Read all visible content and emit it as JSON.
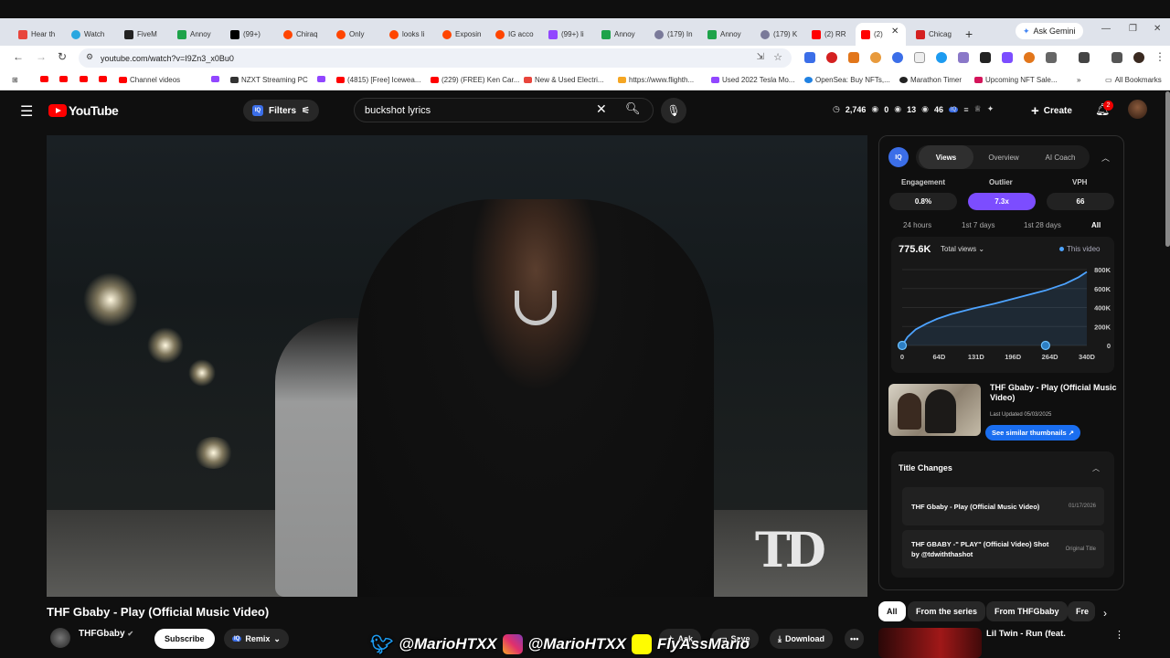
{
  "browser": {
    "tabs": [
      {
        "label": "Hear th",
        "color": "#e8453c"
      },
      {
        "label": "Watch",
        "color": "#2aa7e0"
      },
      {
        "label": "FiveM",
        "color": "#222222"
      },
      {
        "label": "Annoy",
        "color": "#1ea34a"
      },
      {
        "label": "(99+)",
        "color": "#000000"
      },
      {
        "label": "Chiraq",
        "color": "#ff4500"
      },
      {
        "label": "Only",
        "color": "#ff4500"
      },
      {
        "label": "looks li",
        "color": "#ff4500"
      },
      {
        "label": "Exposin",
        "color": "#ff4500"
      },
      {
        "label": "IG acco",
        "color": "#ff4500"
      },
      {
        "label": "(99+) li",
        "color": "#9146ff"
      },
      {
        "label": "Annoy",
        "color": "#1ea34a"
      },
      {
        "label": "(179) In",
        "color": "#7a7a9a"
      },
      {
        "label": "Annoy",
        "color": "#1ea34a"
      },
      {
        "label": "(179) K",
        "color": "#7a7a9a"
      },
      {
        "label": "(2) RR",
        "color": "#ff0000"
      },
      {
        "label": "(2)",
        "color": "#ff0000"
      },
      {
        "label": "Chicag",
        "color": "#d42020"
      }
    ],
    "new_tab": "+",
    "ask_gemini": "Ask Gemini",
    "url": "youtube.com/watch?v=I9Zn3_x0Bu0",
    "bookmarks": [
      {
        "label": "",
        "color": "#ff0000"
      },
      {
        "label": "",
        "color": "#ff0000"
      },
      {
        "label": "",
        "color": "#ff0000"
      },
      {
        "label": "",
        "color": "#ff0000"
      },
      {
        "label": "Channel videos",
        "color": "#ff0000"
      },
      {
        "label": "",
        "color": "#9146ff"
      },
      {
        "label": "NZXT Streaming PC",
        "color": "#333333"
      },
      {
        "label": "",
        "color": "#9146ff"
      },
      {
        "label": "(4815) [Free] Icewea...",
        "color": "#ff0000"
      },
      {
        "label": "(229) (FREE) Ken Car...",
        "color": "#ff0000"
      },
      {
        "label": "New & Used Electri...",
        "color": "#e8453c"
      },
      {
        "label": "https://www.flighth...",
        "color": "#f5a623"
      },
      {
        "label": "Used 2022 Tesla Mo...",
        "color": "#9146ff"
      },
      {
        "label": "OpenSea: Buy NFTs,...",
        "color": "#2081e2"
      },
      {
        "label": "Marathon Timer",
        "color": "#222222"
      },
      {
        "label": "Upcoming NFT Sale...",
        "color": "#d4145a"
      }
    ],
    "all_bookmarks": "All Bookmarks"
  },
  "youtube": {
    "logo_text": "YouTube",
    "filters_label": "Filters",
    "search_value": "buckshot lyrics",
    "stats": {
      "a": "2,746",
      "b": "0",
      "c": "13",
      "d": "46"
    },
    "create_label": "Create",
    "notifications": "2"
  },
  "iq": {
    "logo": "IQ",
    "tabs": [
      "Views",
      "Overview",
      "AI Coach"
    ],
    "metrics": [
      {
        "label": "Engagement",
        "value": "0.8%"
      },
      {
        "label": "Outlier",
        "value": "7.3x"
      },
      {
        "label": "VPH",
        "value": "66"
      }
    ],
    "ranges": [
      "24 hours",
      "1st 7 days",
      "1st 28 days",
      "All"
    ],
    "views_total": "775.6K",
    "views_select": "Total views",
    "legend": "This video",
    "thumb_title": "THF Gbaby - Play (Official Music Video)",
    "last_updated": "Last Updated 05/03/2025",
    "similar_label": "See similar thumbnails",
    "title_changes_heading": "Title Changes",
    "title_changes": [
      {
        "title": "THF Gbaby - Play (Official Music Video)",
        "note": "01/17/2026"
      },
      {
        "title": "THF GBABY -\" PLAY\" (Official Video) Shot by @tdwiththashot",
        "note": "Original Title"
      }
    ]
  },
  "chart_data": {
    "type": "line",
    "title": "",
    "xlabel": "",
    "ylabel": "",
    "x_ticks": [
      "0",
      "64D",
      "131D",
      "196D",
      "264D",
      "340D"
    ],
    "y_ticks": [
      "0",
      "200K",
      "400K",
      "600K",
      "800K"
    ],
    "ylim": [
      0,
      800000
    ],
    "xlim": [
      0,
      340
    ],
    "series": [
      {
        "name": "This video",
        "color": "#4da3ff",
        "x": [
          0,
          10,
          25,
          45,
          64,
          90,
          131,
          170,
          196,
          230,
          264,
          300,
          325,
          340
        ],
        "y": [
          0,
          90000,
          170000,
          230000,
          280000,
          330000,
          390000,
          440000,
          480000,
          530000,
          580000,
          650000,
          720000,
          775600
        ]
      }
    ],
    "markers": [
      0,
      264
    ],
    "grid": true
  },
  "video": {
    "watermark": "TD",
    "title": "THF Gbaby - Play (Official Music Video)",
    "channel": "THFGbaby",
    "subscribe": "Subscribe",
    "remix": "Remix",
    "ask": "Ask",
    "save": "Save",
    "download": "Download",
    "overlay_twitter": "@MarioHTXX",
    "overlay_instagram": "@MarioHTXX",
    "overlay_snapchat": "FlyAssMario"
  },
  "recommendations": {
    "chips": [
      "All",
      "From the series",
      "From THFGbaby",
      "Fre"
    ],
    "first_title": "Lil Twin - Run (feat."
  }
}
